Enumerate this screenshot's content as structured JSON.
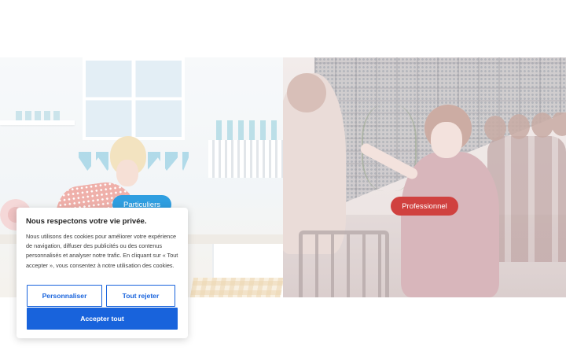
{
  "hero": {
    "left_panel": {
      "category_label": "Particuliers",
      "accent_color": "#2f9ee0"
    },
    "right_panel": {
      "category_label": "Professionnel",
      "accent_color": "#d0413f"
    }
  },
  "cookie_banner": {
    "title": "Nous respectons votre vie privée.",
    "body": "Nous utilisons des cookies pour améliorer votre expérience de navigation, diffuser des publicités ou des contenus personnalisés et analyser notre trafic. En cliquant sur « Tout accepter », vous consentez à notre utilisation des cookies.",
    "buttons": {
      "customize": "Personnaliser",
      "reject": "Tout rejeter",
      "accept": "Accepter tout"
    },
    "primary_color": "#1863dc"
  }
}
